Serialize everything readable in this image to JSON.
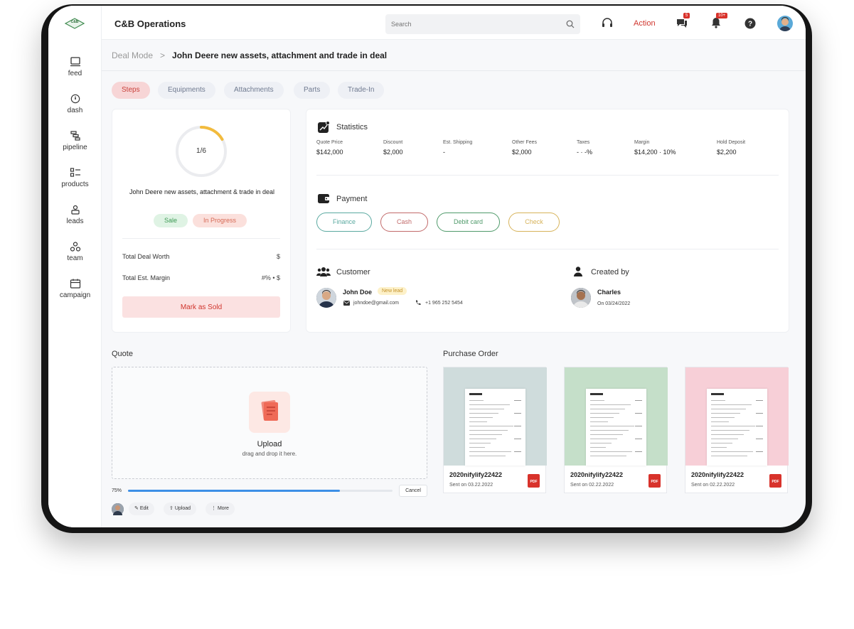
{
  "app": {
    "title": "C&B Operations",
    "logo_text": "C&B"
  },
  "sidebar": {
    "items": [
      {
        "label": "feed"
      },
      {
        "label": "dash"
      },
      {
        "label": "pipeline"
      },
      {
        "label": "products"
      },
      {
        "label": "leads"
      },
      {
        "label": "team"
      },
      {
        "label": "campaign"
      }
    ]
  },
  "topbar": {
    "search_placeholder": "Search",
    "action_label": "Action",
    "messages_badge": "5",
    "notifications_badge": "10+"
  },
  "breadcrumb": {
    "root": "Deal Mode",
    "separator": ">",
    "current": "John Deere new assets, attachment and trade in deal"
  },
  "tabs": [
    {
      "label": "Steps"
    },
    {
      "label": "Equipments"
    },
    {
      "label": "Attachments"
    },
    {
      "label": "Parts"
    },
    {
      "label": "Trade-In"
    }
  ],
  "deal": {
    "progress_label": "1/6",
    "progress_fraction": 0.1667,
    "name": "John Deere new assets, attachment & trade in deal",
    "type_badge": "Sale",
    "status_badge": "In Progress",
    "total_worth_label": "Total Deal Worth",
    "total_worth_value": "$",
    "margin_label": "Total Est. Margin",
    "margin_value": "#% • $",
    "mark_sold_label": "Mark as Sold"
  },
  "statistics": {
    "title": "Statistics",
    "items": [
      {
        "label": "Quote Price",
        "value": "$142,000"
      },
      {
        "label": "Discount",
        "value": "$2,000"
      },
      {
        "label": "Est. Shipping",
        "value": "-"
      },
      {
        "label": "Other Fees",
        "value": "$2,000"
      },
      {
        "label": "Taxes",
        "value": "- · -%"
      },
      {
        "label": "Margin",
        "value": "$14,200 · 10%"
      },
      {
        "label": "Hold Deposit",
        "value": "$2,200"
      }
    ]
  },
  "payment": {
    "title": "Payment",
    "options": [
      {
        "label": "Finance",
        "color": "#5aa9a0"
      },
      {
        "label": "Cash",
        "color": "#c26a6a"
      },
      {
        "label": "Debit card",
        "color": "#4f9a6a"
      },
      {
        "label": "Check",
        "color": "#d7b35a"
      }
    ]
  },
  "customer": {
    "title": "Customer",
    "name": "John Doe",
    "tag": "New lead",
    "email": "johndoe@gmail.com",
    "phone": "+1 965 252 5454"
  },
  "created_by": {
    "title": "Created by",
    "name": "Charles",
    "date": "On 03/24/2022"
  },
  "quote": {
    "title": "Quote",
    "upload_title": "Upload",
    "upload_sub": "drag and drop it here.",
    "progress_label": "75%",
    "progress_fraction": 0.8,
    "cancel_label": "Cancel",
    "actions": [
      {
        "label": "Edit"
      },
      {
        "label": "Upload"
      },
      {
        "label": "More"
      }
    ]
  },
  "purchase_order": {
    "title": "Purchase Order",
    "docs": [
      {
        "name": "2020nifylify22422",
        "date": "Sent on 03.22.2022",
        "bg": "#cfdcdc",
        "file_type": "PDF"
      },
      {
        "name": "2020nifylify22422",
        "date": "Sent on 02.22.2022",
        "bg": "#c5dfc9",
        "file_type": "PDF"
      },
      {
        "name": "2020nifylify22422",
        "date": "Sent on 02.22.2022",
        "bg": "#f7cfd7",
        "file_type": "PDF"
      }
    ]
  }
}
